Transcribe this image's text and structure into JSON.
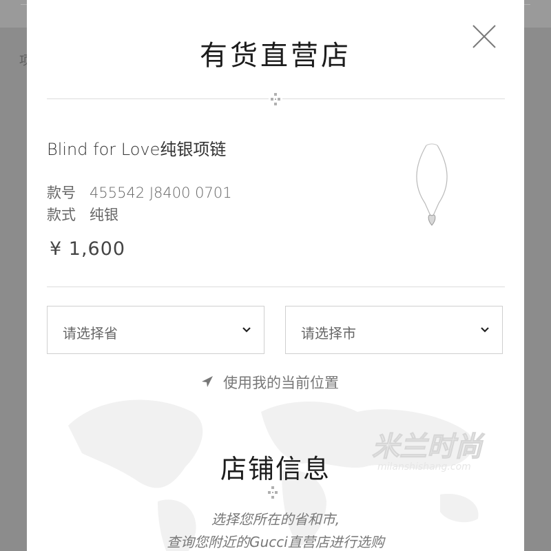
{
  "background": {
    "peek_text": "项"
  },
  "modal": {
    "title": "有货直营店",
    "close_icon": "close-icon"
  },
  "product": {
    "name": "Blind for Love纯银项链",
    "style_no_label": "款号",
    "style_no_value": "455542 J8400 0701",
    "style_label": "款式",
    "style_value": "纯银",
    "price": "¥ 1,600",
    "image_icon": "necklace-icon"
  },
  "selectors": {
    "province_placeholder": "请选择省",
    "city_placeholder": "请选择市"
  },
  "locate": {
    "label": "使用我的当前位置",
    "icon": "location-arrow-icon"
  },
  "store_info": {
    "title": "店铺信息",
    "hint_line1": "选择您所在的省和市,",
    "hint_line2": "查询您附近的Gucci直营店进行选购"
  },
  "watermark": {
    "text": "米兰时尚",
    "subtext": "milanshishang.com"
  },
  "colors": {
    "overlay": "#8c8c8c",
    "modal_bg": "#ffffff",
    "title": "#1c1c1c",
    "border": "#cfcfcf"
  }
}
